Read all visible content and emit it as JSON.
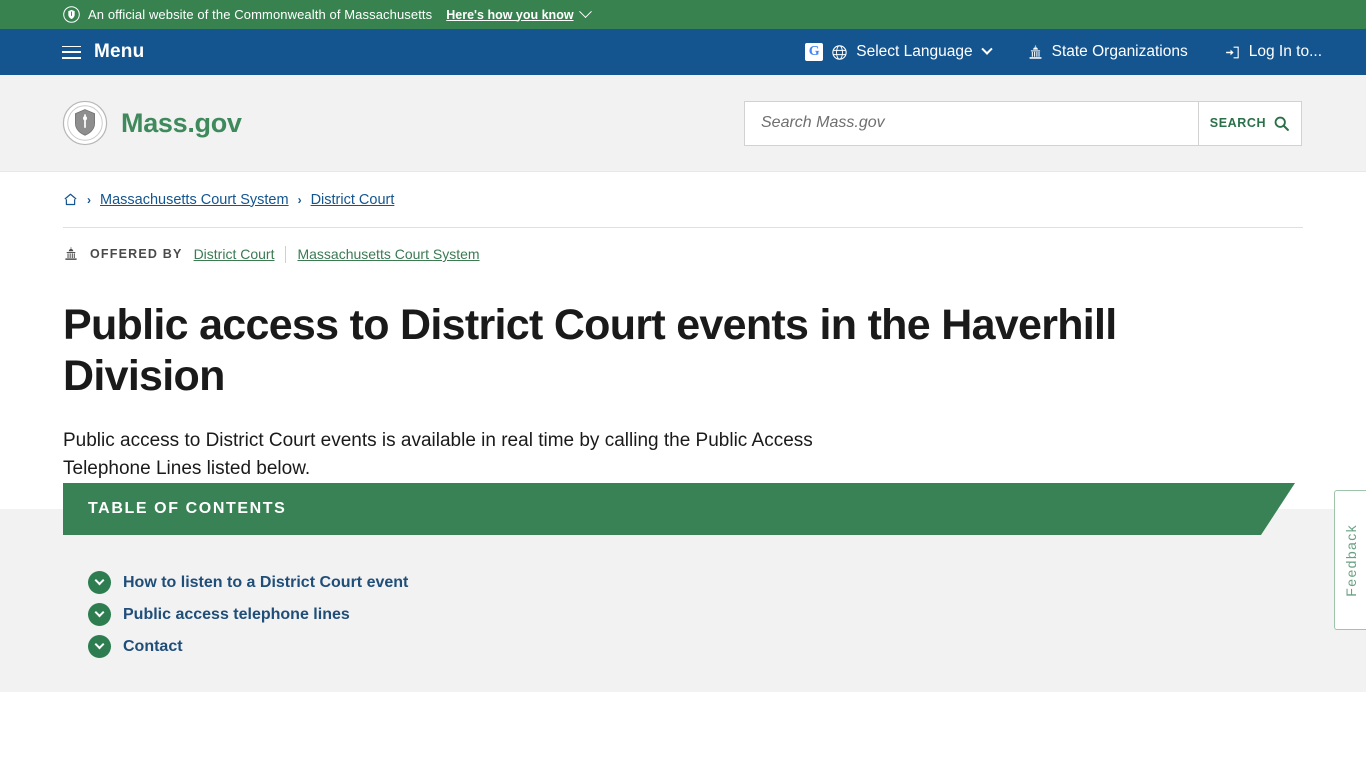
{
  "official_banner": {
    "icon": "shield-icon",
    "text": "An official website of the Commonwealth of Massachusetts",
    "how_you_know": "Here's how you know",
    "background_color": "#388250"
  },
  "main_nav": {
    "menu_label": "Menu",
    "menu_icon": "hamburger-icon",
    "background_color": "#14558f",
    "items": [
      {
        "label": "Select Language",
        "icon": "globe-icon",
        "secondary_icon": "google-translate-icon",
        "has_caret": true
      },
      {
        "label": "State Organizations",
        "icon": "capitol-icon",
        "has_caret": false
      },
      {
        "label": "Log In to...",
        "icon": "login-icon",
        "has_caret": false
      }
    ]
  },
  "header": {
    "logo_icon": "massachusetts-seal-icon",
    "brand_name": "Mass.gov",
    "brand_color": "#3f8a5c",
    "background_color": "#f2f2f2"
  },
  "search": {
    "placeholder": "Search Mass.gov",
    "value": "",
    "button_label": "SEARCH",
    "button_icon": "magnifier-icon"
  },
  "breadcrumb": {
    "home_icon": "home-icon",
    "separator": "›",
    "items": [
      {
        "label": "Massachusetts Court System"
      },
      {
        "label": "District Court"
      }
    ]
  },
  "offered_by": {
    "icon": "capitol-icon",
    "label": "OFFERED BY",
    "links": [
      {
        "label": "District Court"
      },
      {
        "label": "Massachusetts Court System"
      }
    ]
  },
  "page": {
    "title": "Public access to District Court events in the Haverhill Division",
    "subtitle": "Public access to District Court events is available in real time by calling the Public Access Telephone Lines listed below."
  },
  "table_of_contents": {
    "heading": "TABLE OF CONTENTS",
    "banner_color": "#388255",
    "items": [
      {
        "label": "How to listen to a District Court event",
        "icon": "chevron-down-circle-icon"
      },
      {
        "label": "Public access telephone lines",
        "icon": "chevron-down-circle-icon"
      },
      {
        "label": "Contact",
        "icon": "chevron-down-circle-icon"
      }
    ]
  },
  "feedback": {
    "label": "Feedback",
    "color": "#6aa183"
  }
}
